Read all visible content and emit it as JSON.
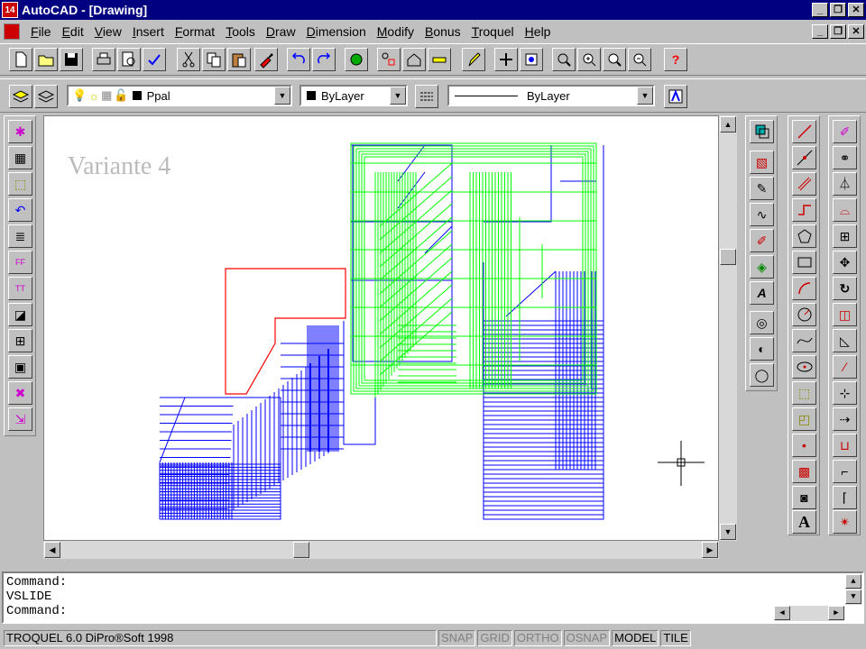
{
  "window": {
    "app": "AutoCAD",
    "title": "AutoCAD - [Drawing]",
    "app_icon_text": "14"
  },
  "menu": [
    "File",
    "Edit",
    "View",
    "Insert",
    "Format",
    "Tools",
    "Draw",
    "Dimension",
    "Modify",
    "Bonus",
    "Troquel",
    "Help"
  ],
  "layer_toolbar": {
    "layer": "Ppal",
    "color": "ByLayer",
    "linetype": "ByLayer"
  },
  "drawing": {
    "label": "Variante 4"
  },
  "command": {
    "lines": [
      "Command:",
      "VSLIDE",
      "Command:"
    ]
  },
  "status": {
    "product": "TROQUEL 6.0 DiPro®Soft 1998",
    "toggles": [
      "SNAP",
      "GRID",
      "ORTHO",
      "OSNAP"
    ],
    "active": [
      "MODEL",
      "TILE"
    ]
  },
  "colors": {
    "title_bg": "#000080",
    "green": "#00ff00",
    "blue": "#0000ff",
    "red": "#ff0000"
  }
}
